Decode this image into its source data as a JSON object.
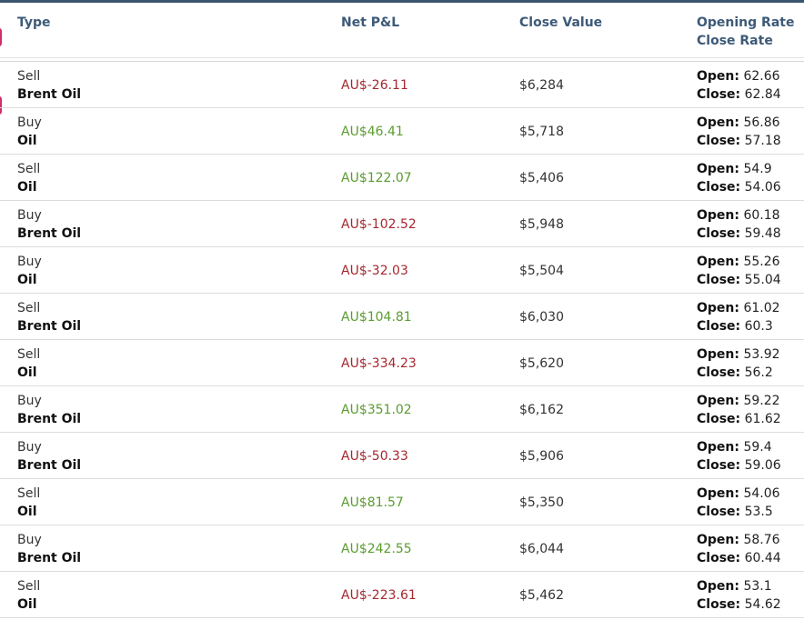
{
  "header": {
    "type": "Type",
    "net_pl": "Net P&L",
    "close_value": "Close Value",
    "opening_rate": "Opening Rate",
    "close_rate": "Close Rate"
  },
  "labels": {
    "open": "Open:",
    "close": "Close:"
  },
  "colors": {
    "negative": "#a6272e",
    "positive": "#5a9c2e",
    "header_text": "#3d5a78",
    "top_border": "#3a5470"
  },
  "rows": [
    {
      "direction": "Sell",
      "instrument": "Brent Oil",
      "pnl": "AU$-26.11",
      "pnl_sign": "negative",
      "close_value": "$6,284",
      "open_rate": "62.66",
      "close_rate": "62.84"
    },
    {
      "direction": "Buy",
      "instrument": "Oil",
      "pnl": "AU$46.41",
      "pnl_sign": "positive",
      "close_value": "$5,718",
      "open_rate": "56.86",
      "close_rate": "57.18"
    },
    {
      "direction": "Sell",
      "instrument": "Oil",
      "pnl": "AU$122.07",
      "pnl_sign": "positive",
      "close_value": "$5,406",
      "open_rate": "54.9",
      "close_rate": "54.06"
    },
    {
      "direction": "Buy",
      "instrument": "Brent Oil",
      "pnl": "AU$-102.52",
      "pnl_sign": "negative",
      "close_value": "$5,948",
      "open_rate": "60.18",
      "close_rate": "59.48"
    },
    {
      "direction": "Buy",
      "instrument": "Oil",
      "pnl": "AU$-32.03",
      "pnl_sign": "negative",
      "close_value": "$5,504",
      "open_rate": "55.26",
      "close_rate": "55.04"
    },
    {
      "direction": "Sell",
      "instrument": "Brent Oil",
      "pnl": "AU$104.81",
      "pnl_sign": "positive",
      "close_value": "$6,030",
      "open_rate": "61.02",
      "close_rate": "60.3"
    },
    {
      "direction": "Sell",
      "instrument": "Oil",
      "pnl": "AU$-334.23",
      "pnl_sign": "negative",
      "close_value": "$5,620",
      "open_rate": "53.92",
      "close_rate": "56.2"
    },
    {
      "direction": "Buy",
      "instrument": "Brent Oil",
      "pnl": "AU$351.02",
      "pnl_sign": "positive",
      "close_value": "$6,162",
      "open_rate": "59.22",
      "close_rate": "61.62"
    },
    {
      "direction": "Buy",
      "instrument": "Brent Oil",
      "pnl": "AU$-50.33",
      "pnl_sign": "negative",
      "close_value": "$5,906",
      "open_rate": "59.4",
      "close_rate": "59.06"
    },
    {
      "direction": "Sell",
      "instrument": "Oil",
      "pnl": "AU$81.57",
      "pnl_sign": "positive",
      "close_value": "$5,350",
      "open_rate": "54.06",
      "close_rate": "53.5"
    },
    {
      "direction": "Buy",
      "instrument": "Brent Oil",
      "pnl": "AU$242.55",
      "pnl_sign": "positive",
      "close_value": "$6,044",
      "open_rate": "58.76",
      "close_rate": "60.44"
    },
    {
      "direction": "Sell",
      "instrument": "Oil",
      "pnl": "AU$-223.61",
      "pnl_sign": "negative",
      "close_value": "$5,462",
      "open_rate": "53.1",
      "close_rate": "54.62"
    }
  ]
}
